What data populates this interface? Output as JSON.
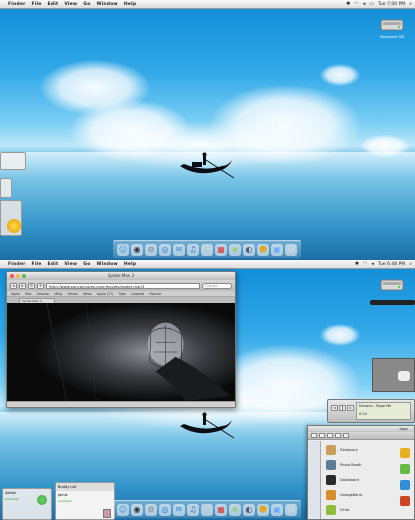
{
  "screen1": {
    "menubar": {
      "apple": "",
      "items": [
        "Finder",
        "File",
        "Edit",
        "View",
        "Go",
        "Window",
        "Help"
      ],
      "clock": "Tue 7:00 PM"
    },
    "hd_label": "Macintosh HD"
  },
  "screen2": {
    "menubar": {
      "apple": "",
      "items": [
        "Finder",
        "File",
        "Edit",
        "View",
        "Go",
        "Window",
        "Help"
      ],
      "clock": "Tue 6:48 PM"
    },
    "browser": {
      "title": "Spider-Man 3",
      "url": "http://www.sonypictures.com/movies/spider-man3",
      "search_placeholder": "Google",
      "bookmarks": [
        "Apple",
        "Mac",
        "Amazon",
        "eBay",
        "Yahoo!",
        "News",
        "Apple (27)",
        "Tiger",
        "Leopard",
        "Popular"
      ],
      "tab": "Spider-Man 3"
    },
    "itunes": {
      "title": "Nirvana - Rape Me",
      "time": "0:24"
    },
    "finder": {
      "title": "Apps",
      "items": [
        {
          "name": "Dictionary",
          "color": "#c9a05a"
        },
        {
          "name": "Photo Booth",
          "color": "#5a7d9a"
        },
        {
          "name": "Dashboard",
          "color": "#2b2b2b"
        },
        {
          "name": "GarageBand",
          "color": "#d88c2a"
        },
        {
          "name": "iChat",
          "color": "#8fbf3a"
        }
      ],
      "right_icons": [
        "#e8b020",
        "#66bb44",
        "#2f8fd8",
        "#cc4422"
      ]
    },
    "chat_widget": {
      "name": "Adrian",
      "status": "Available"
    },
    "im_widget": {
      "title": "Buddy List",
      "name": "Jamie",
      "status": "Available"
    }
  },
  "dock_icons": [
    {
      "name": "finder-icon",
      "glyph": "☺",
      "color": "#3a8fd6"
    },
    {
      "name": "dashboard-icon",
      "glyph": "◉",
      "color": "#333"
    },
    {
      "name": "system-preferences-icon",
      "glyph": "⚙",
      "color": "#888"
    },
    {
      "name": "safari-icon",
      "glyph": "◎",
      "color": "#2a7ad0"
    },
    {
      "name": "mail-icon",
      "glyph": "✉",
      "color": "#4a8ad8"
    },
    {
      "name": "itunes-icon",
      "glyph": "♫",
      "color": "#3a6ab8"
    },
    {
      "name": "textedit-icon",
      "glyph": "✎",
      "color": "#ccc"
    },
    {
      "name": "ical-icon",
      "glyph": "▦",
      "color": "#d33"
    },
    {
      "name": "photo-icon",
      "glyph": "❀",
      "color": "#9c6"
    },
    {
      "name": "quicktime-icon",
      "glyph": "◐",
      "color": "#557"
    },
    {
      "name": "adium-icon",
      "glyph": "☻",
      "color": "#e9a000"
    },
    {
      "name": "preview-icon",
      "glyph": "▣",
      "color": "#6af"
    },
    {
      "name": "trash-icon",
      "glyph": "▭",
      "color": "#ddd"
    }
  ],
  "colors": {
    "sky": "#1f8fd8",
    "menubar": "#e6e6e6"
  }
}
